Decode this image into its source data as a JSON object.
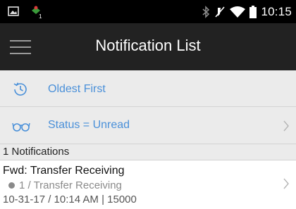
{
  "status_bar": {
    "time": "10:15",
    "left_icons": [
      "image-icon",
      "app-notification-icon"
    ],
    "right_icons": [
      "bluetooth-icon",
      "mute-icon",
      "wifi-icon",
      "battery-icon"
    ],
    "app_badge": "1"
  },
  "app_bar": {
    "title": "Notification List",
    "menu_icon": "hamburger-menu-icon"
  },
  "filters": {
    "sort": {
      "label": "Oldest First",
      "icon": "history-clock-icon",
      "color": "#4a90d9"
    },
    "status": {
      "label": "Status = Unread",
      "icon": "glasses-icon",
      "color": "#4a90d9"
    }
  },
  "list": {
    "count_label": "1 Notifications",
    "items": [
      {
        "title": "Fwd: Transfer Receiving",
        "subtitle": "1 / Transfer Receiving",
        "meta": "10-31-17 / 10:14 AM | 15000"
      }
    ]
  },
  "colors": {
    "status_bar_bg": "#000000",
    "app_bar_bg": "#222222",
    "row_bg": "#ebebeb",
    "accent": "#4a90d9"
  }
}
